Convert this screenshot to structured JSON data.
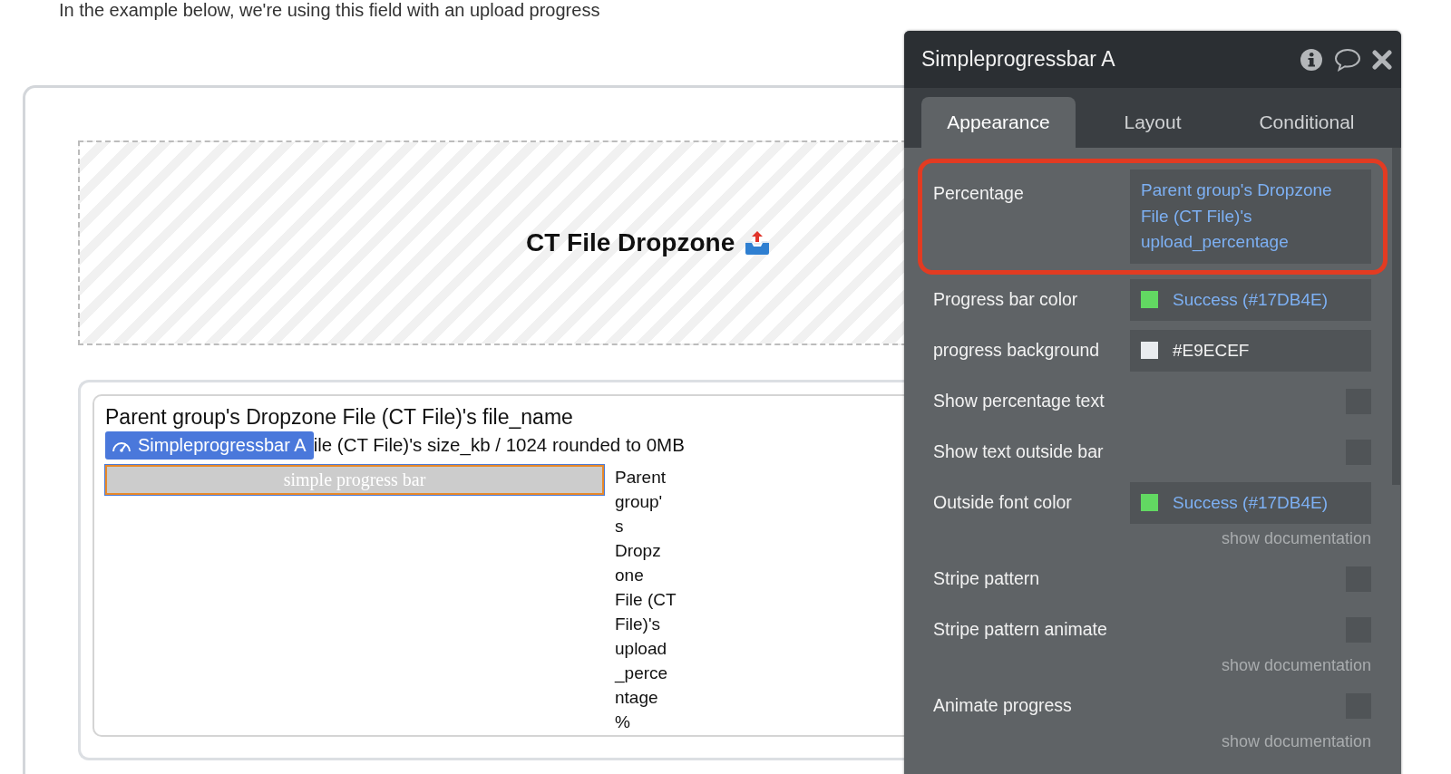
{
  "intro": "In the example below, we're using this field with an upload progress",
  "canvas": {
    "dropzone": {
      "title": "CT File Dropzone"
    },
    "group": {
      "title": "Parent group's Dropzone File (CT File)'s file_name",
      "badge": "Simpleprogressbar A",
      "size_text": "ile (CT File)'s size_kb / 1024 rounded to 0MB",
      "progress_bar": {
        "label": "simple progress bar",
        "selected": true
      },
      "percentage_lines": [
        "Parent",
        "group'",
        "s",
        "Dropz",
        "one",
        "File (CT",
        "File)'s",
        "upload",
        "_perce",
        "ntage",
        "%"
      ]
    }
  },
  "panel": {
    "title": "Simpleprogressbar A",
    "tabs": [
      {
        "label": "Appearance",
        "selected": true
      },
      {
        "label": "Layout",
        "selected": false
      },
      {
        "label": "Conditional",
        "selected": false
      }
    ],
    "properties": [
      {
        "kind": "dynamic",
        "label": "Percentage",
        "value": "Parent group's Dropzone File (CT File)'s upload_percentage",
        "highlighted": true
      },
      {
        "kind": "color",
        "label": "Progress bar color",
        "color": "#62d862",
        "value": "Success (#17DB4E)",
        "linked": true
      },
      {
        "kind": "color",
        "label": "progress background",
        "color": "#e9ecef",
        "value": "#E9ECEF",
        "linked": false
      },
      {
        "kind": "checkbox",
        "label": "Show percentage text",
        "checked": false
      },
      {
        "kind": "checkbox",
        "label": "Show text outside bar",
        "checked": false
      },
      {
        "kind": "color",
        "label": "Outside font color",
        "color": "#62d862",
        "value": "Success (#17DB4E)",
        "linked": true,
        "documentation": "show documentation"
      },
      {
        "kind": "checkbox",
        "label": "Stripe pattern",
        "checked": false
      },
      {
        "kind": "checkbox",
        "label": "Stripe pattern animate",
        "checked": false,
        "documentation": "show documentation"
      },
      {
        "kind": "checkbox",
        "label": "Animate progress",
        "checked": false,
        "documentation": "show documentation"
      }
    ]
  }
}
